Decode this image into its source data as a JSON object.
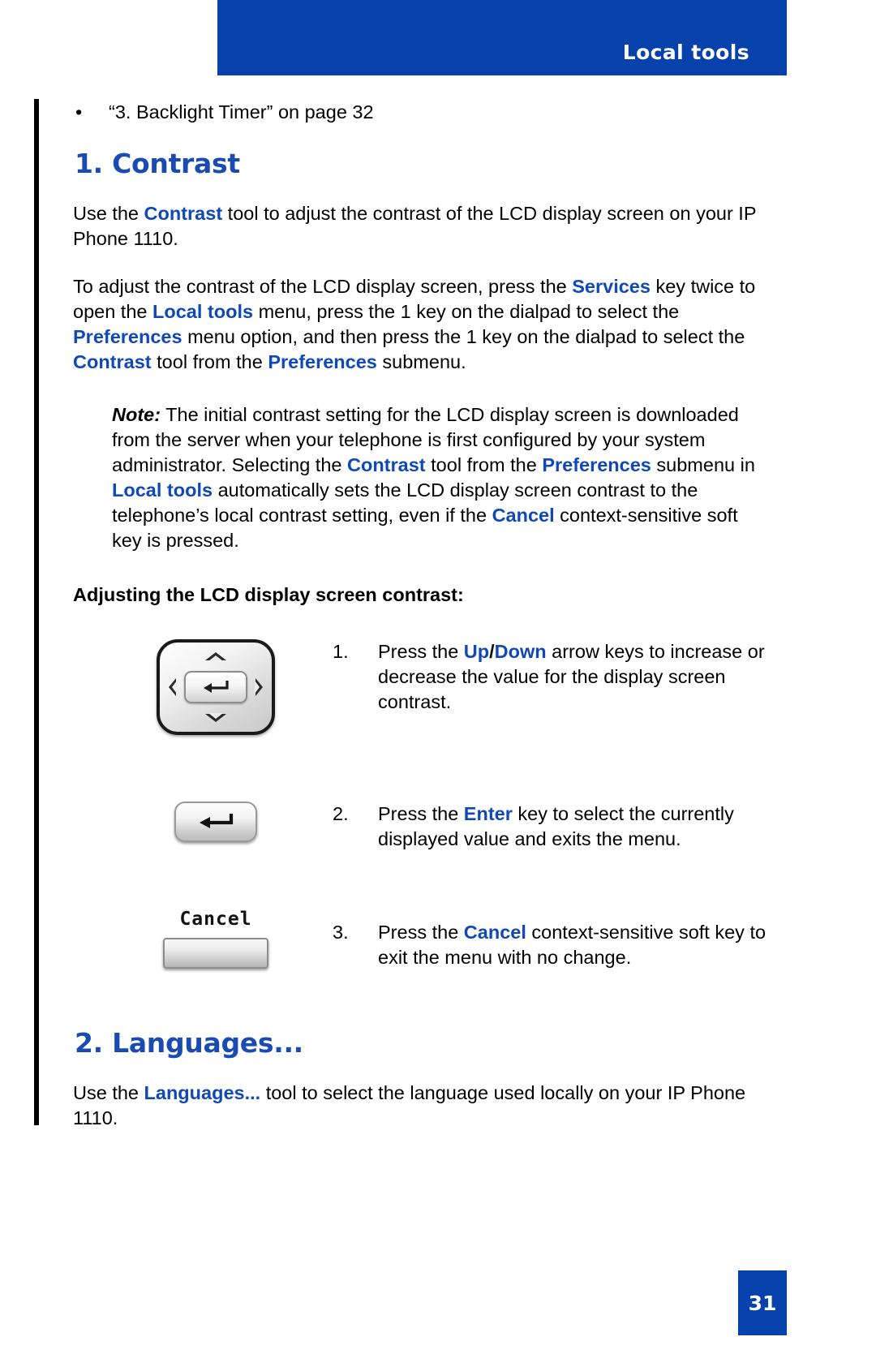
{
  "header": {
    "title": "Local tools",
    "bar_color": "#0641AC"
  },
  "accent_color": "#1049B5",
  "cross_reference": {
    "bullet": "•",
    "text": "“3. Backlight Timer” on page 32"
  },
  "sections": [
    {
      "heading": "1. Contrast",
      "paragraph1": {
        "part1": "Use the ",
        "kw1": "Contrast",
        "part2": " tool to adjust the contrast of the LCD display screen on your IP Phone 1110."
      },
      "paragraph2": {
        "part1": "To adjust the contrast of the LCD display screen, press the ",
        "kw1": "Services",
        "part2": " key twice to open the ",
        "kw2": "Local tools",
        "part3": " menu, press the 1 key on the dialpad to select the ",
        "kw3": "Preferences",
        "part4": " menu option, and then press the 1 key on the dialpad to select the ",
        "kw4": "Contrast",
        "part5": " tool from the ",
        "kw5": "Preferences",
        "part6": " submenu."
      },
      "note": {
        "label": "Note:",
        "part1": " The initial contrast setting for the LCD display screen is downloaded from the server when your telephone is first configured by your system administrator. Selecting the ",
        "kw1": "Contrast",
        "part2": " tool from the ",
        "kw2": "Preferences",
        "part3": " submenu in ",
        "kw3": "Local tools",
        "part4": " automatically sets the LCD display screen contrast to the telephone’s local contrast setting, even if the ",
        "kw4": "Cancel",
        "part5": " context-sensitive soft key is pressed."
      },
      "procedure_heading": "Adjusting the LCD display screen contrast:",
      "steps": [
        {
          "number": "1.",
          "figure": "navigation-cluster",
          "part1": "Press the ",
          "kw1": "Up",
          "separator": "/",
          "kw2": "Down",
          "part2": " arrow keys to increase or decrease the value for the display screen contrast."
        },
        {
          "number": "2.",
          "figure": "enter-key",
          "part1": "Press the ",
          "kw1": "Enter",
          "part2": " key to select the currently displayed value and exits the menu."
        },
        {
          "number": "3.",
          "figure": "cancel-softkey",
          "softkey_label": "Cancel",
          "part1": "Press the ",
          "kw1": "Cancel",
          "part2": " context-sensitive soft key to exit the menu with no change."
        }
      ]
    },
    {
      "heading": "2. Languages...",
      "paragraph1": {
        "part1": "Use the ",
        "kw1": "Languages...",
        "part2": " tool to select the language used locally on your IP Phone 1110."
      }
    }
  ],
  "footer": {
    "page_number": "31"
  }
}
